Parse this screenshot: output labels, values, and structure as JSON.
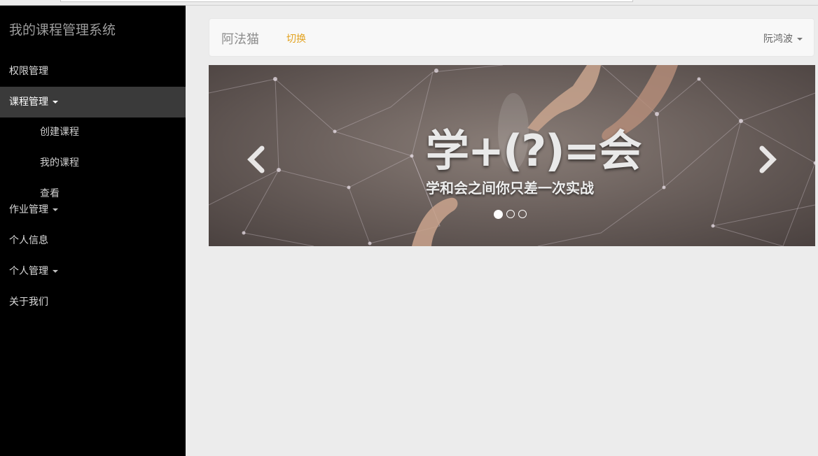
{
  "sidebar": {
    "brand": "我的课程管理系统",
    "items": [
      {
        "label": "权限管理"
      },
      {
        "label": "课程管理",
        "active": true,
        "children": [
          "创建课程",
          "我的课程",
          "查看"
        ]
      },
      {
        "label": "作业管理"
      },
      {
        "label": "个人信息"
      },
      {
        "label": "个人管理"
      },
      {
        "label": "关于我们"
      }
    ]
  },
  "topbar": {
    "title": "阿法猫",
    "switch_label": "切换",
    "user_name": "阮鸿波"
  },
  "carousel": {
    "headline": "学+(?)=会",
    "subtitle": "学和会之间你只差一次实战",
    "slide_count": 3,
    "active_index": 0,
    "prev_icon": "chevron-left-icon",
    "next_icon": "chevron-right-icon"
  },
  "colors": {
    "sidebar_bg": "#000000",
    "active_item_bg": "#3a3a3a",
    "accent": "#e3a321",
    "page_bg": "#ececec"
  }
}
